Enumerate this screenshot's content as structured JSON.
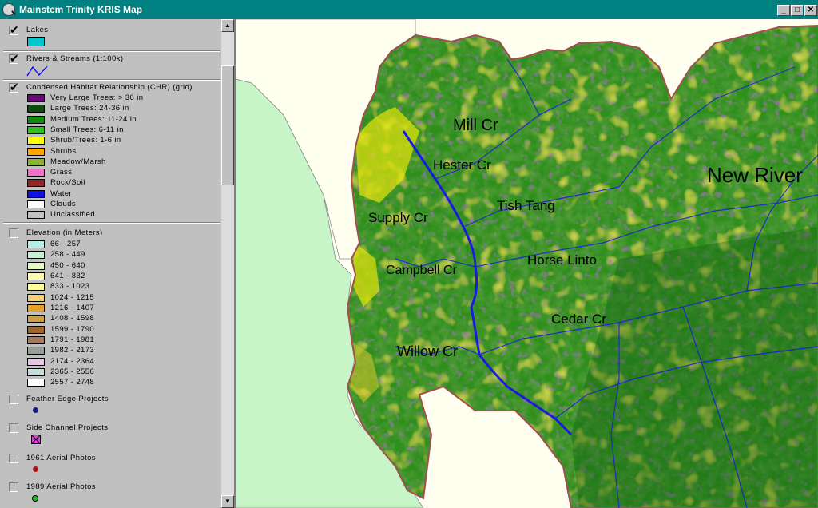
{
  "window": {
    "title": "Mainstem Trinity KRIS Map",
    "controls": {
      "minimize": "_",
      "maximize": "□",
      "close": "✕"
    }
  },
  "legend": {
    "layers": [
      {
        "name": "Lakes",
        "checked": true,
        "symbol": "swatch",
        "symbol_color": "#00c8d0"
      },
      {
        "name": "Rivers & Streams (1:100k)",
        "checked": true,
        "symbol": "line",
        "symbol_color": "#0000ff"
      },
      {
        "name": "Condensed Habitat Relationship (CHR) (grid)",
        "checked": true,
        "classes": [
          {
            "label": "Very Large Trees: > 36 in",
            "color": "#6a0a78"
          },
          {
            "label": "Large Trees: 24-36 in",
            "color": "#0a4a0a"
          },
          {
            "label": "Medium Trees: 11-24 in",
            "color": "#108a10"
          },
          {
            "label": "Small Trees: 6-11 in",
            "color": "#30c020"
          },
          {
            "label": "Shrub/Trees: 1-6 in",
            "color": "#ffff00"
          },
          {
            "label": "Shrubs",
            "color": "#ffa500"
          },
          {
            "label": "Meadow/Marsh",
            "color": "#8cb432"
          },
          {
            "label": "Grass",
            "color": "#f070c8"
          },
          {
            "label": "Rock/Soil",
            "color": "#8c2828"
          },
          {
            "label": "Water",
            "color": "#1010e0"
          },
          {
            "label": "Clouds",
            "color": "#ffffff"
          },
          {
            "label": "Unclassified",
            "color": "#c0c0c0"
          }
        ]
      },
      {
        "name": "Elevation (in Meters)",
        "checked": false,
        "classes": [
          {
            "label": "66 - 257",
            "color": "#b4f0e6"
          },
          {
            "label": "258 - 449",
            "color": "#c8f0d2"
          },
          {
            "label": "450 - 640",
            "color": "#e6fac8"
          },
          {
            "label": "641 - 832",
            "color": "#fafab4"
          },
          {
            "label": "833 - 1023",
            "color": "#ffff9a"
          },
          {
            "label": "1024 - 1215",
            "color": "#f0d278"
          },
          {
            "label": "1216 - 1407",
            "color": "#e6a028"
          },
          {
            "label": "1408 - 1598",
            "color": "#c8a050"
          },
          {
            "label": "1599 - 1790",
            "color": "#a06428"
          },
          {
            "label": "1791 - 1981",
            "color": "#a07864"
          },
          {
            "label": "1982 - 2173",
            "color": "#96a096"
          },
          {
            "label": "2174 - 2364",
            "color": "#e6c8e6"
          },
          {
            "label": "2365 - 2556",
            "color": "#c8dcdc"
          },
          {
            "label": "2557 - 2748",
            "color": "#ffffff"
          }
        ]
      },
      {
        "name": "Feather Edge Projects",
        "checked": false,
        "symbol": "dot",
        "symbol_color": "#1a1a8c"
      },
      {
        "name": "Side Channel Projects",
        "checked": false,
        "symbol": "xbox",
        "symbol_color": "#e040e0"
      },
      {
        "name": "1961 Aerial Photos",
        "checked": false,
        "symbol": "dot",
        "symbol_color": "#b41414"
      },
      {
        "name": "1989 Aerial Photos",
        "checked": false,
        "symbol": "ring",
        "symbol_color": "#20c020"
      }
    ]
  },
  "map": {
    "labels": [
      "Mill Cr",
      "Hester Cr",
      "New River",
      "Tish Tang",
      "Supply Cr",
      "Horse Linto",
      "Campbell Cr",
      "Cedar Cr",
      "Willow Cr"
    ],
    "colors": {
      "background": "#fffff0",
      "outside_boundary": "#c8f5c8",
      "basin": "#2f8f1f",
      "boundary": "#a05050",
      "river": "#1a1ae0"
    }
  }
}
